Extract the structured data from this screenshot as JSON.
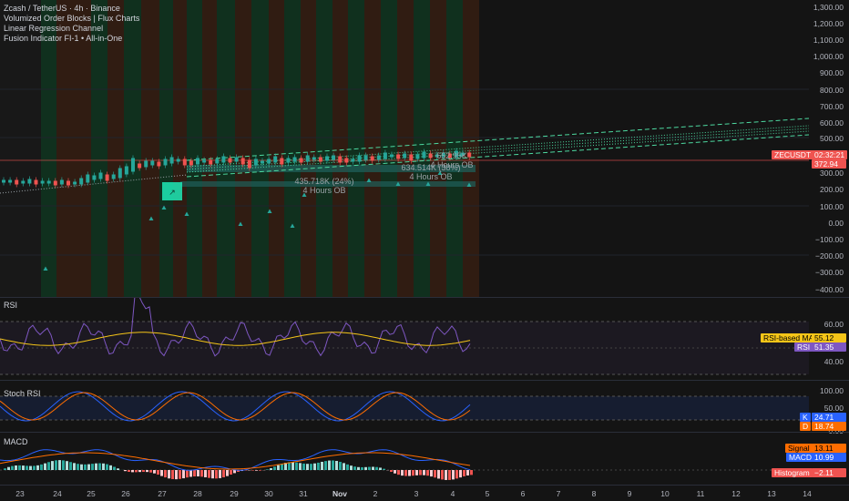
{
  "legend": {
    "line1": "Zcash / TetherUS · 4h · Binance",
    "line2": "Volumized Order Blocks | Flux Charts",
    "line3": "Linear Regression Channel",
    "line4": "Fusion Indicator FI-1 • All-in-One"
  },
  "price_axis": {
    "labels": [
      "1,300.00",
      "1,200.00",
      "1,100.00",
      "1,000.00",
      "900.00",
      "800.00",
      "700.00",
      "600.00",
      "500.00",
      "300.00",
      "200.00",
      "100.00",
      "0.00",
      "−100.00",
      "−200.00",
      "−300.00",
      "−400.00"
    ],
    "symbol_tag": "ZECUSDT",
    "countdown": "02:32:21",
    "last_price": "372.94"
  },
  "order_blocks": [
    {
      "value": "634.514K (38%)",
      "label": "4 Hours OB"
    },
    {
      "value": "435.718K (24%)",
      "label": "4 Hours OB"
    },
    {
      "value": "652.95K",
      "label": "4 Hours OB"
    }
  ],
  "rsi": {
    "title": "RSI",
    "axis": [
      "60.00",
      "40.00"
    ],
    "ma_label": "RSI-based MA",
    "ma_value": "55.12",
    "rsi_label": "RSI",
    "rsi_value": "51.35"
  },
  "stoch": {
    "title": "Stoch RSI",
    "axis": [
      "100.00",
      "50.00",
      "0.00"
    ],
    "k_label": "K",
    "k_value": "24.71",
    "d_label": "D",
    "d_value": "18.74"
  },
  "macd": {
    "title": "MACD",
    "signal_label": "Signal",
    "signal_value": "13.11",
    "macd_label": "MACD",
    "macd_value": "10.99",
    "hist_label": "Histogram",
    "hist_value": "−2.11"
  },
  "time_axis": [
    "23",
    "24",
    "25",
    "26",
    "27",
    "28",
    "29",
    "30",
    "31",
    "Nov",
    "2",
    "3",
    "4",
    "5",
    "6",
    "7",
    "8",
    "9",
    "10",
    "11",
    "12",
    "13",
    "14"
  ],
  "colors": {
    "up": "#26a69a",
    "down": "#ef5350",
    "rsi": "#7e57c2",
    "rsi_ma": "#f5c518",
    "stoch_k": "#2962ff",
    "stoch_d": "#ff6d00",
    "macd": "#2962ff",
    "signal": "#ff6d00",
    "channel": "#4dd9a0"
  }
}
